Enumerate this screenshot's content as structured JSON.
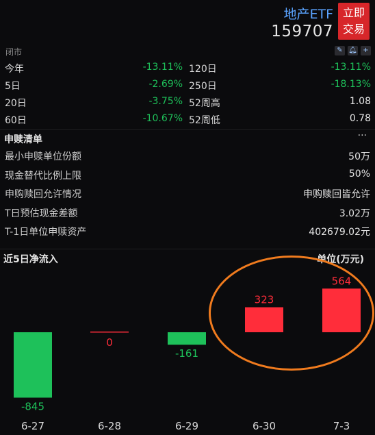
{
  "header": {
    "etf_name": "地产ETF",
    "etf_code": "159707",
    "trade_line1": "立即",
    "trade_line2": "交易"
  },
  "status": {
    "market_state": "闭市"
  },
  "performance": [
    {
      "l1": "今年",
      "v1": "-13.11%",
      "l2": "120日",
      "v2": "-13.11%",
      "v2_color": "green"
    },
    {
      "l1": "5日",
      "v1": "-2.69%",
      "l2": "250日",
      "v2": "-18.13%",
      "v2_color": "green"
    },
    {
      "l1": "20日",
      "v1": "-3.75%",
      "l2": "52周高",
      "v2": "1.08",
      "v2_color": "white"
    },
    {
      "l1": "60日",
      "v1": "-10.67%",
      "l2": "52周低",
      "v2": "0.78",
      "v2_color": "white"
    }
  ],
  "subscription": {
    "title": "申赎清单",
    "more": "···",
    "rows": [
      {
        "label": "最小申赎单位份额",
        "value": "50万"
      },
      {
        "label": "现金替代比例上限",
        "value": "50%"
      },
      {
        "label": "申购赎回允许情况",
        "value": "申购赎回皆允许"
      },
      {
        "label": "T日预估现金差额",
        "value": "3.02万"
      },
      {
        "label": "T-1日单位申赎资产",
        "value": "402679.02元"
      }
    ]
  },
  "net_inflow": {
    "title": "近5日净流入",
    "unit": "单位(万元)"
  },
  "chart_data": {
    "type": "bar",
    "categories": [
      "6-27",
      "6-28",
      "6-29",
      "6-30",
      "7-3"
    ],
    "values": [
      -845,
      0,
      -161,
      323,
      564
    ],
    "positive_color": "#ff2d3a",
    "negative_color": "#1ec15a"
  }
}
